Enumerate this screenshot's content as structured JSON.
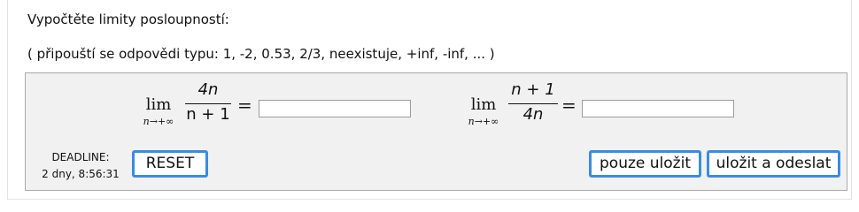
{
  "prompt": "Vypočtěte limity posloupností:",
  "hint": "( připouští se odpovědi typu: 1, -2, 0.53, 2/3, neexistuje, +inf, -inf, ... )",
  "problems": [
    {
      "lim_word": "lim",
      "lim_sub": "n→+∞",
      "numerator": "4n",
      "denominator": "n + 1",
      "equals": "=",
      "answer_value": ""
    },
    {
      "lim_word": "lim",
      "lim_sub": "n→+∞",
      "numerator": "n + 1",
      "denominator": "4n",
      "equals": "=",
      "answer_value": ""
    }
  ],
  "deadline": {
    "label": "DEADLINE:",
    "value": "2 dny, 8:56:31"
  },
  "buttons": {
    "reset": "RESET",
    "save_only": "pouze uložit",
    "save_submit": "uložit a odeslat"
  },
  "colors": {
    "button_border": "#3a8be0",
    "panel_bg": "#f1f1f1"
  }
}
